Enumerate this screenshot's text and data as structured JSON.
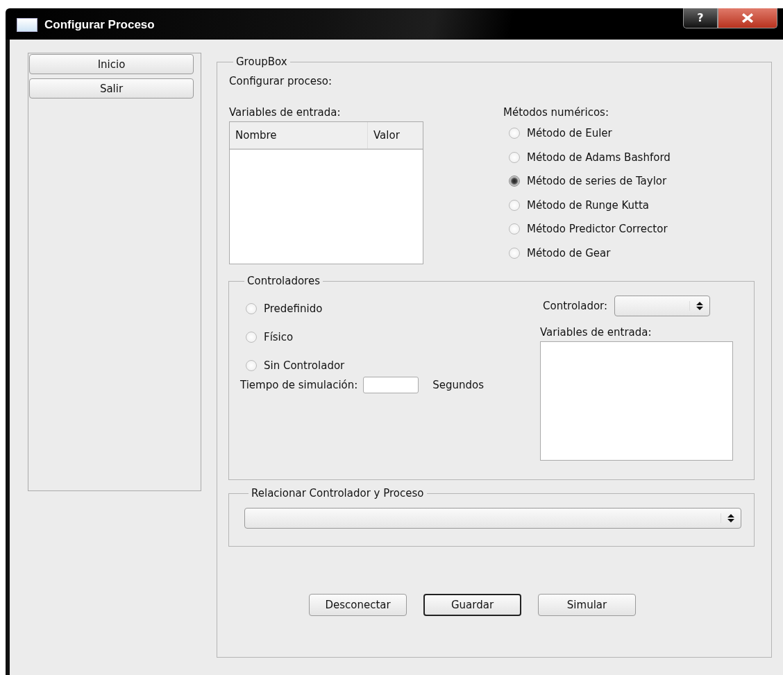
{
  "window": {
    "title": "Configurar Proceso",
    "help_label": "?"
  },
  "sidebar": {
    "buttons": [
      {
        "label": "Inicio"
      },
      {
        "label": "Salir"
      }
    ]
  },
  "group_box": {
    "title": "GroupBox",
    "heading": "Configurar proceso:",
    "input_variables": {
      "label": "Variables de entrada:",
      "columns": [
        "Nombre",
        "Valor"
      ]
    },
    "numeric_methods": {
      "label": "Métodos numéricos:",
      "options": [
        {
          "label": "Método de Euler",
          "selected": false
        },
        {
          "label": "Método de Adams Bashford",
          "selected": false
        },
        {
          "label": "Método de series de Taylor",
          "selected": true
        },
        {
          "label": "Método de Runge Kutta",
          "selected": false
        },
        {
          "label": "Método Predictor Corrector",
          "selected": false
        },
        {
          "label": "Método de Gear",
          "selected": false
        }
      ]
    },
    "controllers": {
      "title": "Controladores",
      "options": [
        {
          "label": "Predefinido",
          "selected": false
        },
        {
          "label": "Físico",
          "selected": false
        },
        {
          "label": "Sin Controlador",
          "selected": false
        }
      ],
      "simulation_time": {
        "label": "Tiempo de simulación:",
        "unit": "Segundos"
      },
      "controller": {
        "label": "Controlador:"
      },
      "input_variables_label": "Variables de entrada:"
    },
    "relate": {
      "title": "Relacionar Controlador y Proceso"
    },
    "buttons": [
      {
        "label": "Desconectar",
        "default": false
      },
      {
        "label": "Guardar",
        "default": true
      },
      {
        "label": "Simular",
        "default": false
      }
    ]
  }
}
